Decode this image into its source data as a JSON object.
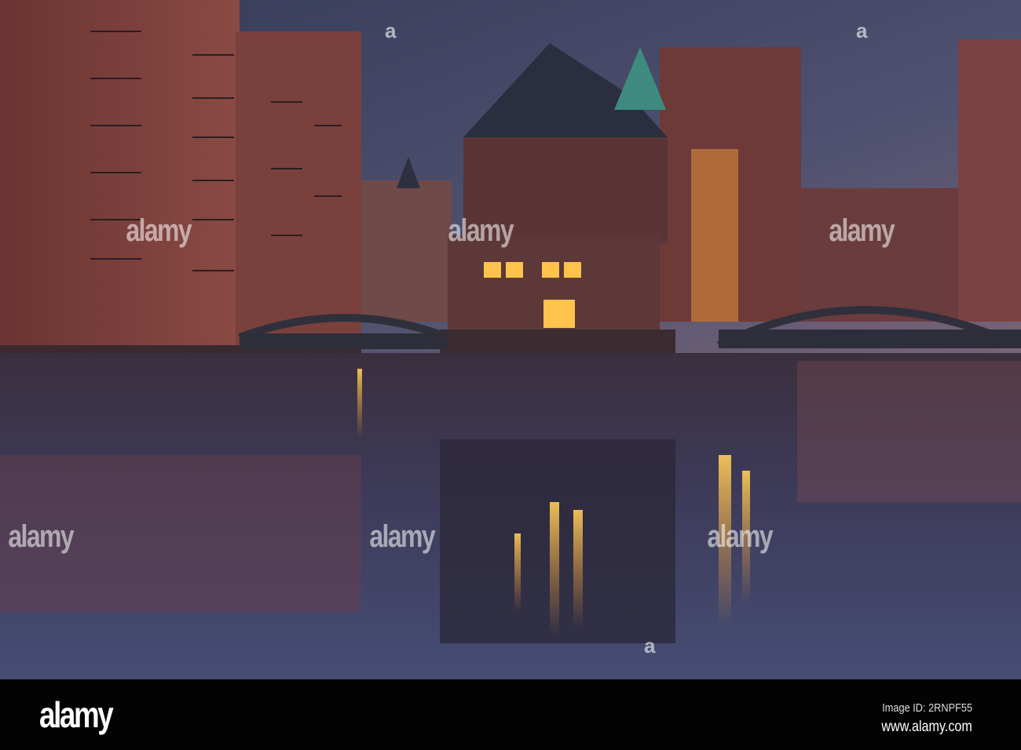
{
  "photo": {
    "subject": "Wasserschloss, Speicherstadt canal at dusk",
    "colors": {
      "sky_top": "#3a3f5c",
      "sky_bottom": "#6c6078",
      "brick": "#7a3c38",
      "brick_dark": "#4a2a2c",
      "water": "#3a3c5a",
      "light": "#ffc24a",
      "roof": "#2c3040",
      "copper": "#3f8a80"
    }
  },
  "watermark": {
    "text": "alamy",
    "mark": "a"
  },
  "footer": {
    "logo": "alamy",
    "image_id": "Image ID: 2RNPF55",
    "website": "www.alamy.com"
  }
}
